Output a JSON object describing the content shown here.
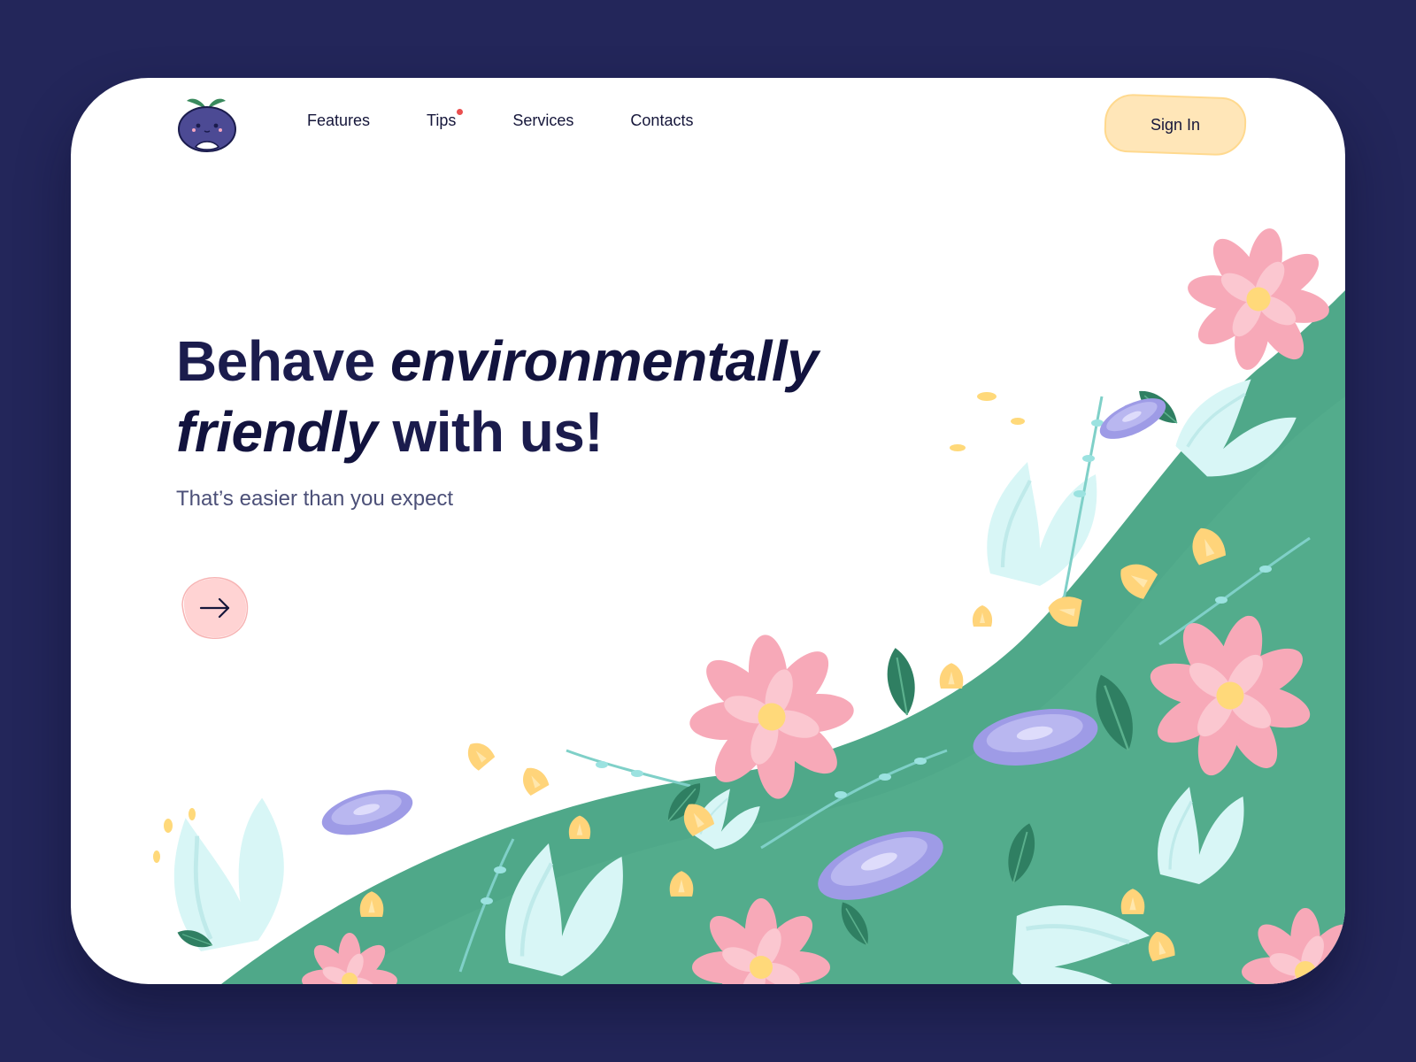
{
  "nav": {
    "items": [
      {
        "label": "Features",
        "has_dot": false
      },
      {
        "label": "Tips",
        "has_dot": true
      },
      {
        "label": "Services",
        "has_dot": false
      },
      {
        "label": "Contacts",
        "has_dot": false
      }
    ],
    "signin_label": "Sign In"
  },
  "hero": {
    "headline_part1": "Behave ",
    "headline_em1": "environmentally",
    "headline_em2": "friendly",
    "headline_part2": " with us!",
    "subtitle": "That’s easier than you expect"
  },
  "icons": {
    "logo": "plum-mascot-logo",
    "cta": "arrow-right-icon",
    "notification": "red-dot"
  },
  "colors": {
    "page_background": "#23265a",
    "card_background": "#ffffff",
    "heading": "#1b1c4d",
    "subtitle": "#4c5078",
    "signin_fill": "#ffe6b8",
    "cta_fill": "#ffd3d3",
    "hill_green": "#4fa889",
    "accent_dot": "#ea4f4f"
  }
}
